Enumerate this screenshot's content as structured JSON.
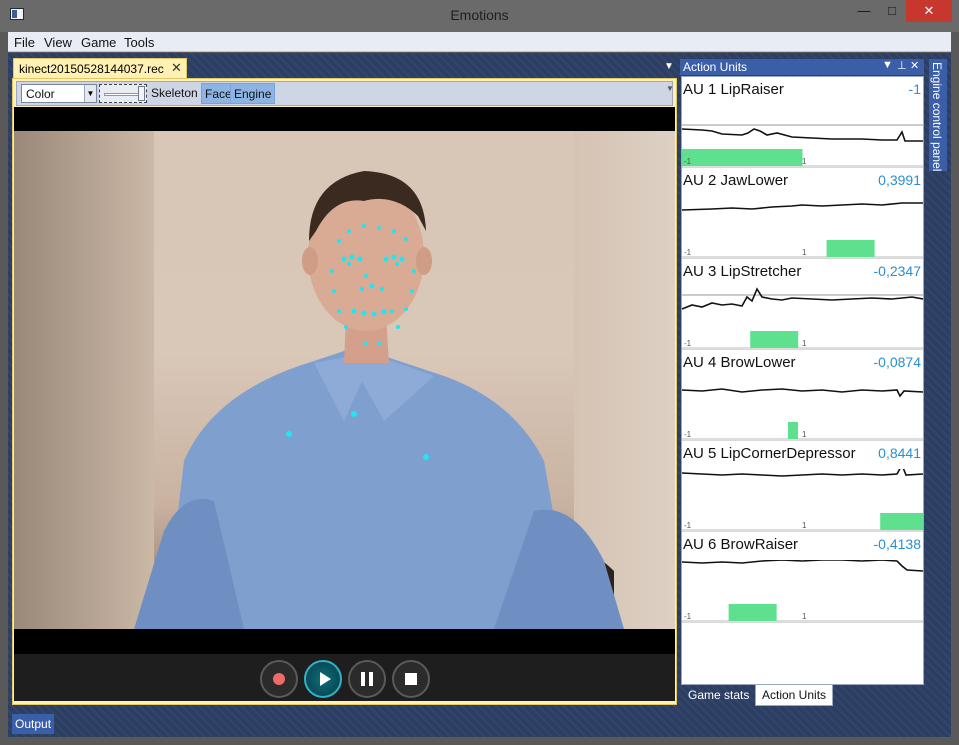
{
  "window": {
    "title": "Emotions",
    "minimize": "—",
    "maximize": "□",
    "close": "✕"
  },
  "menu": [
    "File",
    "View",
    "Game",
    "Tools"
  ],
  "document": {
    "tab_label": "kinect20150528144037.rec",
    "close": "✕",
    "tab_dropdown": "▼",
    "toolbar": {
      "stream_select": "Color",
      "select_arrow": "▼",
      "skeleton_label": "Skeleton",
      "face_toggle": "Face",
      "engine_toggle": "Engine",
      "grip": "▼"
    }
  },
  "playback": {
    "record_icon": "record-icon",
    "play_icon": "play-icon",
    "pause_icon": "pause-icon",
    "stop_icon": "stop-icon"
  },
  "action_units_panel": {
    "title": "Action Units",
    "dropdown_icon": "▼",
    "pin_icon": "⊥",
    "close_icon": "✕",
    "axis_min": "-1",
    "axis_max": "1",
    "units": [
      {
        "name": "AU 1 LipRaiser",
        "value": "-1",
        "numeric": -1
      },
      {
        "name": "AU 2 JawLower",
        "value": "0,3991",
        "numeric": 0.3991
      },
      {
        "name": "AU 3 LipStretcher",
        "value": "-0,2347",
        "numeric": -0.2347
      },
      {
        "name": "AU 4 BrowLower",
        "value": "-0,0874",
        "numeric": -0.0874
      },
      {
        "name": "AU 5 LipCornerDepressor",
        "value": "0,8441",
        "numeric": 0.8441
      },
      {
        "name": "AU 6 BrowRaiser",
        "value": "-0,4138",
        "numeric": -0.4138
      }
    ],
    "bar_color": "#5fe08e",
    "value_color": "#2a8fd4"
  },
  "side_tab": "Engine control panel",
  "bottom_tabs": {
    "game_stats": "Game stats",
    "action_units": "Action Units"
  },
  "output_tab": "Output"
}
